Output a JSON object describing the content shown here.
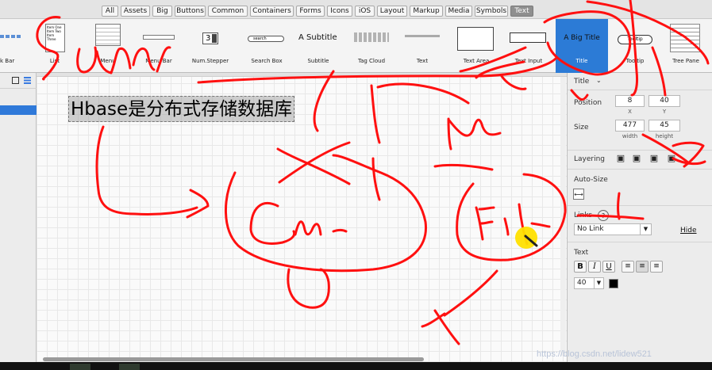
{
  "filter_tabs": [
    {
      "label": "All",
      "active": false
    },
    {
      "label": "Assets",
      "active": false
    },
    {
      "label": "Big",
      "active": false
    },
    {
      "label": "Buttons",
      "active": false
    },
    {
      "label": "Common",
      "active": false
    },
    {
      "label": "Containers",
      "active": false
    },
    {
      "label": "Forms",
      "active": false
    },
    {
      "label": "Icons",
      "active": false
    },
    {
      "label": "iOS",
      "active": false
    },
    {
      "label": "Layout",
      "active": false
    },
    {
      "label": "Markup",
      "active": false
    },
    {
      "label": "Media",
      "active": false
    },
    {
      "label": "Symbols",
      "active": false
    },
    {
      "label": "Text",
      "active": true
    }
  ],
  "library": {
    "items": [
      "k Bar",
      "List",
      "Menu",
      "Menu Bar",
      "Num.Stepper",
      "Search Box",
      "Subtitle",
      "Tag Cloud",
      "Text",
      "Text Area",
      "Text Input",
      "Title",
      "Tooltip",
      "Tree Pane"
    ],
    "list_rows": [
      "Item One",
      "Item Two",
      "Item Three"
    ],
    "stepper_value": "3",
    "search_placeholder": "search",
    "subtitle_text": "A Subtitle",
    "title_text": "A Big Title",
    "tooltip_text": "Tooltip"
  },
  "canvas": {
    "title_text": "Hbase是分布式存储数据库"
  },
  "inspector": {
    "header": "Title",
    "position_label": "Position",
    "position_x": "8",
    "position_y": "40",
    "x_caption": "X",
    "y_caption": "Y",
    "size_label": "Size",
    "width": "477",
    "height": "45",
    "width_caption": "width",
    "height_caption": "height",
    "layering_label": "Layering",
    "autosize_label": "Auto-Size",
    "links_label": "Links",
    "links_help": "?",
    "link_value": "No Link",
    "hide_link": "Hide",
    "text_label": "Text",
    "bold": "B",
    "italic": "I",
    "underline": "U",
    "font_size": "40"
  },
  "watermark": "https://blog.csdn.net/lidew521",
  "colors": {
    "active_tab": "#8f8f8f",
    "selection_blue": "#2f79d9",
    "title_thumb_blue": "#2c7bd6",
    "annotation_red": "#ff1010",
    "pointer_yellow": "#ffe000"
  }
}
